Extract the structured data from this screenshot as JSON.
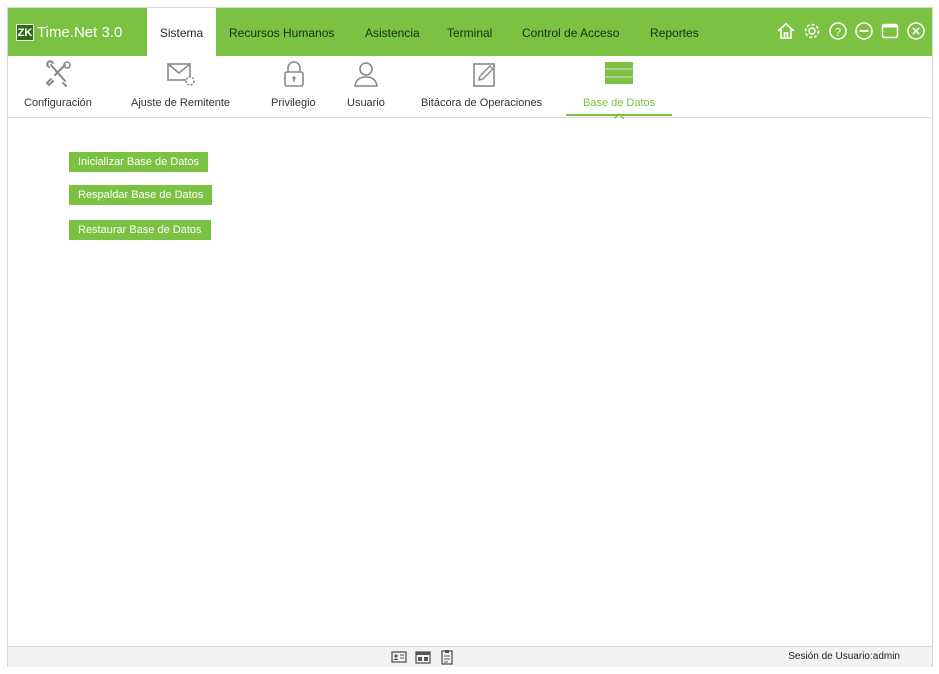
{
  "app": {
    "logo_badge": "ZK",
    "title": "Time.Net 3.0",
    "accent_color": "#7bc142"
  },
  "menu": {
    "tabs": [
      {
        "label": "Sistema",
        "active": true
      },
      {
        "label": "Recursos Humanos",
        "active": false
      },
      {
        "label": "Asistencia",
        "active": false
      },
      {
        "label": "Terminal",
        "active": false
      },
      {
        "label": "Control de Acceso",
        "active": false
      },
      {
        "label": "Reportes",
        "active": false
      }
    ],
    "window_icons": [
      "home-icon",
      "gear-icon",
      "help-icon",
      "minimize-icon",
      "maximize-icon",
      "close-icon"
    ]
  },
  "toolbar": {
    "items": [
      {
        "label": "Configuración",
        "icon": "tools-icon"
      },
      {
        "label": "Ajuste de Remitente",
        "icon": "mail-settings-icon"
      },
      {
        "label": "Privilegio",
        "icon": "lock-icon"
      },
      {
        "label": "Usuario",
        "icon": "user-icon"
      },
      {
        "label": "Bitácora de Operaciones",
        "icon": "edit-log-icon"
      },
      {
        "label": "Base de Datos",
        "icon": "database-icon",
        "active": true
      }
    ]
  },
  "actions": {
    "init_db": "Inicializar Base de Datos",
    "backup_db": "Respaldar Base de Datos",
    "restore_db": "Restaurar Base de Datos"
  },
  "statusbar": {
    "icons": [
      "id-card-icon",
      "device-icon",
      "clipboard-icon"
    ],
    "session_text": "Sesión de Usuario:admin"
  }
}
